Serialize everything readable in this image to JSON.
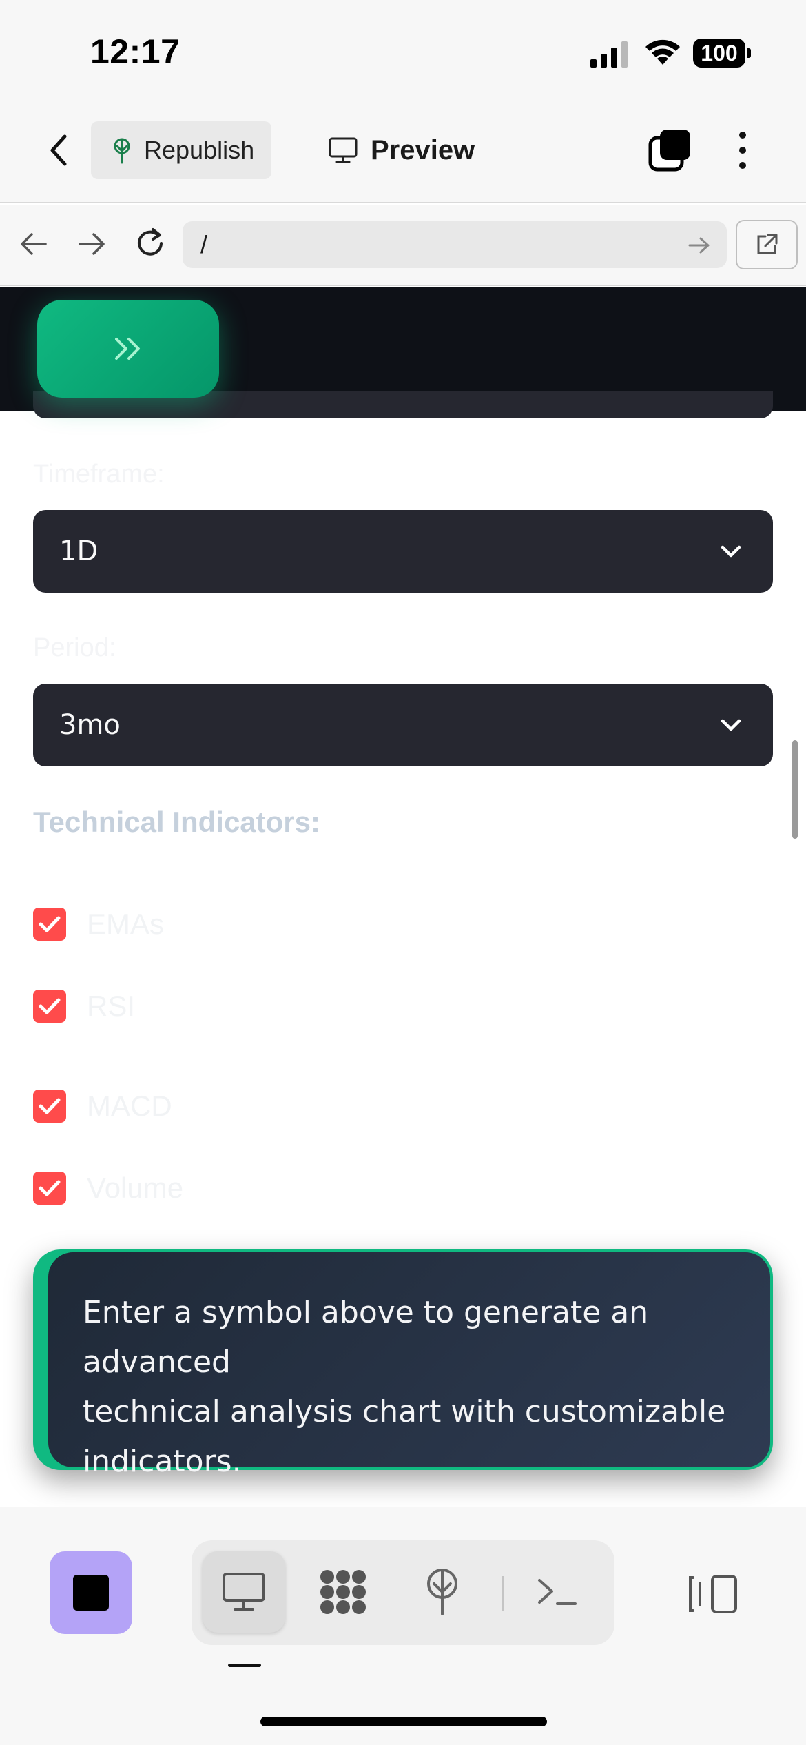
{
  "status_bar": {
    "time": "12:17",
    "battery": "100"
  },
  "toolbar": {
    "republish_label": "Republish",
    "preview_label": "Preview"
  },
  "url_bar": {
    "url": "/"
  },
  "form": {
    "timeframe": {
      "label": "Timeframe:",
      "selected": "1D"
    },
    "period": {
      "label": "Period:",
      "selected": "3mo"
    },
    "indicators_title": "Technical Indicators:",
    "indicators": [
      {
        "label": "EMAs",
        "checked": true
      },
      {
        "label": "RSI",
        "checked": true
      },
      {
        "label": "MACD",
        "checked": true
      },
      {
        "label": "Volume",
        "checked": true
      }
    ]
  },
  "info_card": {
    "line1": "Enter a symbol above to generate an advanced",
    "line2": "technical analysis chart with customizable",
    "line3": "indicators."
  },
  "colors": {
    "accent_green": "#10b981",
    "checkbox_red": "#ff4b4b",
    "dark_bg": "#0e1117",
    "select_bg": "#262730",
    "stop_button": "#b4a3f7"
  },
  "icons": {
    "back": "chevron-left-icon",
    "republish": "publish-tree-icon",
    "preview": "monitor-icon",
    "tabs": "tabs-icon",
    "more": "more-vertical-icon",
    "nav_back": "arrow-left-icon",
    "nav_forward": "arrow-right-icon",
    "reload": "reload-icon",
    "go": "arrow-right-icon",
    "open_external": "external-link-icon",
    "expand": "double-chevron-right-icon",
    "dropdown": "chevron-down-icon",
    "check": "checkmark-icon",
    "stop": "stop-icon",
    "bottom_modes": [
      "monitor-icon",
      "grid-pattern-icon",
      "publish-tree-icon",
      "terminal-icon"
    ],
    "panel": "split-panel-icon"
  }
}
